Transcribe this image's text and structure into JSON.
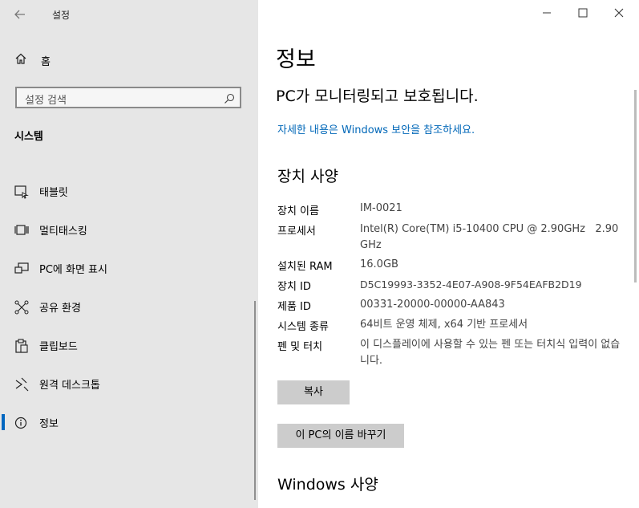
{
  "window": {
    "title": "설정"
  },
  "sidebar": {
    "home_label": "홈",
    "search_placeholder": "설정 검색",
    "section_title": "시스템",
    "items": [
      {
        "label": "태블릿",
        "icon": "tablet-icon"
      },
      {
        "label": "멀티태스킹",
        "icon": "multitasking-icon"
      },
      {
        "label": "PC에 화면 표시",
        "icon": "project-icon"
      },
      {
        "label": "공유 환경",
        "icon": "shared-experiences-icon"
      },
      {
        "label": "클립보드",
        "icon": "clipboard-icon"
      },
      {
        "label": "원격 데스크톱",
        "icon": "remote-desktop-icon"
      },
      {
        "label": "정보",
        "icon": "info-icon",
        "selected": true
      }
    ]
  },
  "main": {
    "title": "정보",
    "protection_status": "PC가 모니터링되고 보호됩니다.",
    "security_link": "자세한 내용은 Windows 보안을 참조하세요.",
    "device_specs_title": "장치 사양",
    "specs": [
      {
        "label": "장치 이름",
        "value": "IM-0021"
      },
      {
        "label": "프로세서",
        "value": "Intel(R) Core(TM) i5-10400 CPU @ 2.90GHz   2.90 GHz"
      },
      {
        "label": "설치된 RAM",
        "value": "16.0GB"
      },
      {
        "label": "장치 ID",
        "value": "D5C19993-3352-4E07-A908-9F54EAFB2D19"
      },
      {
        "label": "제품 ID",
        "value": "00331-20000-00000-AA843"
      },
      {
        "label": "시스템 종류",
        "value": "64비트 운영 체제, x64 기반 프로세서"
      },
      {
        "label": "펜 및 터치",
        "value": "이 디스플레이에 사용할 수 있는 펜 또는 터치식 입력이 없습니다."
      }
    ],
    "copy_button": "복사",
    "rename_button": "이 PC의 이름 바꾸기",
    "windows_specs_title": "Windows 사양"
  },
  "colors": {
    "accent": "#0067c0",
    "link": "#0067b8",
    "sidebar_bg": "#e6e6e6",
    "button_bg": "#cccccc"
  }
}
